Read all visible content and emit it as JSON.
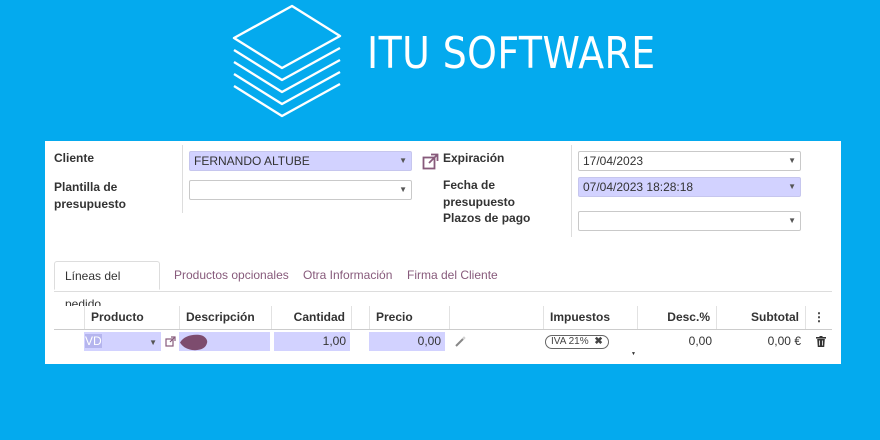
{
  "brand": {
    "name": "ITU SOFTWARE",
    "logo_icon": "layers-logo-icon"
  },
  "form": {
    "cliente": {
      "label": "Cliente",
      "value": "FERNANDO ALTUBE"
    },
    "plantilla": {
      "label": "Plantilla de\npresupuesto",
      "value": ""
    },
    "expiracion": {
      "label": "Expiración",
      "value": "17/04/2023"
    },
    "fecha": {
      "label": "Fecha de\npresupuesto",
      "value": "07/04/2023 18:28:18"
    },
    "plazos": {
      "label": "Plazos de pago",
      "value": ""
    }
  },
  "tabs": [
    {
      "label": "Líneas del pedido",
      "active": true
    },
    {
      "label": "Productos opcionales"
    },
    {
      "label": "Otra Información"
    },
    {
      "label": "Firma del Cliente"
    }
  ],
  "table": {
    "headers": {
      "producto": "Producto",
      "descripcion": "Descripción",
      "cantidad": "Cantidad",
      "precio": "Precio unit…",
      "impuestos": "Impuestos",
      "desc": "Desc.%",
      "subtotal": "Subtotal"
    },
    "row": {
      "producto": "VD",
      "descripcion": "",
      "cantidad": "1,00",
      "precio": "0,00",
      "impuesto_tag": "IVA 21%",
      "desc": "0,00",
      "subtotal": "0,00 €"
    }
  },
  "colors": {
    "background": "#04aaee",
    "required_field": "#d2d2ff",
    "tab_link": "#875a7b"
  }
}
